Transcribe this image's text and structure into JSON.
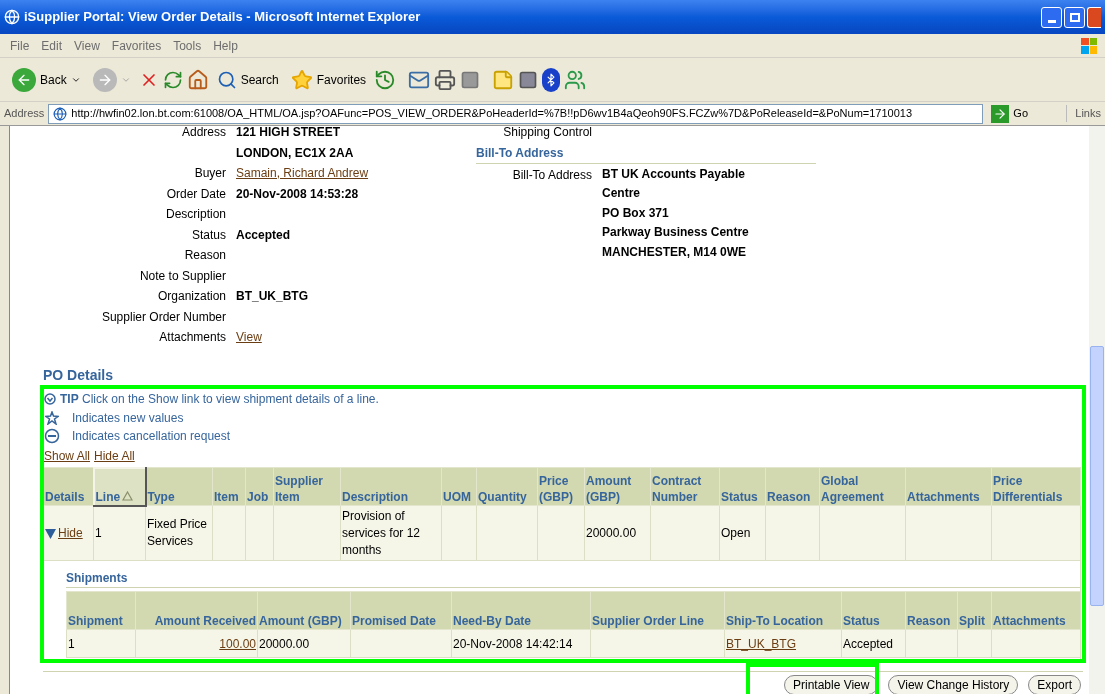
{
  "window": {
    "title": "iSupplier Portal: View Order Details - Microsoft Internet Explorer"
  },
  "menu": [
    "File",
    "Edit",
    "View",
    "Favorites",
    "Tools",
    "Help"
  ],
  "toolbar": {
    "back": "Back",
    "search": "Search",
    "favorites": "Favorites"
  },
  "address_bar": {
    "label": "Address",
    "url": "http://hwfin02.lon.bt.com:61008/OA_HTML/OA.jsp?OAFunc=POS_VIEW_ORDER&PoHeaderId=%7B!!pD6wv1B4aQeoh90FS.FCZw%7D&PoReleaseId=&PoNum=1710013",
    "go": "Go",
    "links": "Links"
  },
  "header_fields": [
    {
      "label": "Address",
      "kind": "text",
      "values": [
        "121 HIGH STREET",
        "LONDON, EC1X 2AA"
      ]
    },
    {
      "label": "Buyer",
      "kind": "link",
      "values": [
        "Samain, Richard Andrew"
      ]
    },
    {
      "label": "Order Date",
      "kind": "text",
      "values": [
        "20-Nov-2008 14:53:28"
      ]
    },
    {
      "label": "Description"
    },
    {
      "label": "Status",
      "kind": "text",
      "values": [
        "Accepted"
      ]
    },
    {
      "label": "Reason"
    },
    {
      "label": "Note to Supplier"
    },
    {
      "label": "Organization",
      "kind": "text",
      "values": [
        "BT_UK_BTG"
      ]
    },
    {
      "label": "Supplier Order Number"
    },
    {
      "label": "Attachments",
      "kind": "link",
      "values": [
        "View"
      ]
    }
  ],
  "shipping_control": {
    "label": "Shipping Control"
  },
  "bill_to": {
    "title": "Bill-To Address",
    "label": "Bill-To Address",
    "values": [
      "BT UK Accounts Payable Centre",
      "PO Box 371",
      "Parkway Business Centre",
      "MANCHESTER, M14 0WE"
    ]
  },
  "po_details": {
    "title": "PO Details",
    "tip": "**TIP** Click on the Show link to view shipment details of a line.",
    "legend": [
      {
        "kind": "new",
        "text": "Indicates new values"
      },
      {
        "kind": "cancel",
        "text": "Indicates cancellation request"
      }
    ],
    "links": [
      "Show All",
      "Hide All"
    ],
    "columns": [
      {
        "label": "Details",
        "sorted": false
      },
      {
        "label": "Line",
        "sorted": true
      },
      {
        "label": "Type",
        "sorted": false
      },
      {
        "label": "Item",
        "sorted": false
      },
      {
        "label": "Job",
        "sorted": false
      },
      {
        "label": "Supplier Item",
        "sorted": false
      },
      {
        "label": "Description",
        "sorted": false
      },
      {
        "label": "UOM",
        "sorted": false
      },
      {
        "label": "Quantity",
        "sorted": false
      },
      {
        "label": "Price (GBP)",
        "sorted": false
      },
      {
        "label": "Amount (GBP)",
        "sorted": false
      },
      {
        "label": "Contract Number",
        "sorted": false
      },
      {
        "label": "Status",
        "sorted": false
      },
      {
        "label": "Reason",
        "sorted": false
      },
      {
        "label": "Global Agreement",
        "sorted": false
      },
      {
        "label": "Attachments",
        "sorted": false
      },
      {
        "label": "Price Differentials",
        "sorted": false
      }
    ],
    "lines": [
      {
        "expanded": true,
        "toggle": "Hide",
        "line": "1",
        "type": "Fixed Price Services",
        "description": "Provision of services for 12 months",
        "amount": "20000.00",
        "status": "Open",
        "shipments": {
          "title": "Shipments",
          "columns": [
            "Shipment",
            "Amount Received",
            "Amount (GBP)",
            "Promised Date",
            "Need-By Date",
            "Supplier Order Line",
            "Ship-To Location",
            "Status",
            "Reason",
            "Split",
            "Attachments"
          ],
          "rows": [
            {
              "shipment": "1",
              "amount_received": "100.00",
              "amount": "20000.00",
              "need_by_date": "20-Nov-2008 14:42:14",
              "ship_to_location": "BT_UK_BTG",
              "status": "Accepted"
            }
          ]
        }
      }
    ]
  },
  "buttons": [
    "Printable View",
    "View Change History",
    "Export"
  ]
}
